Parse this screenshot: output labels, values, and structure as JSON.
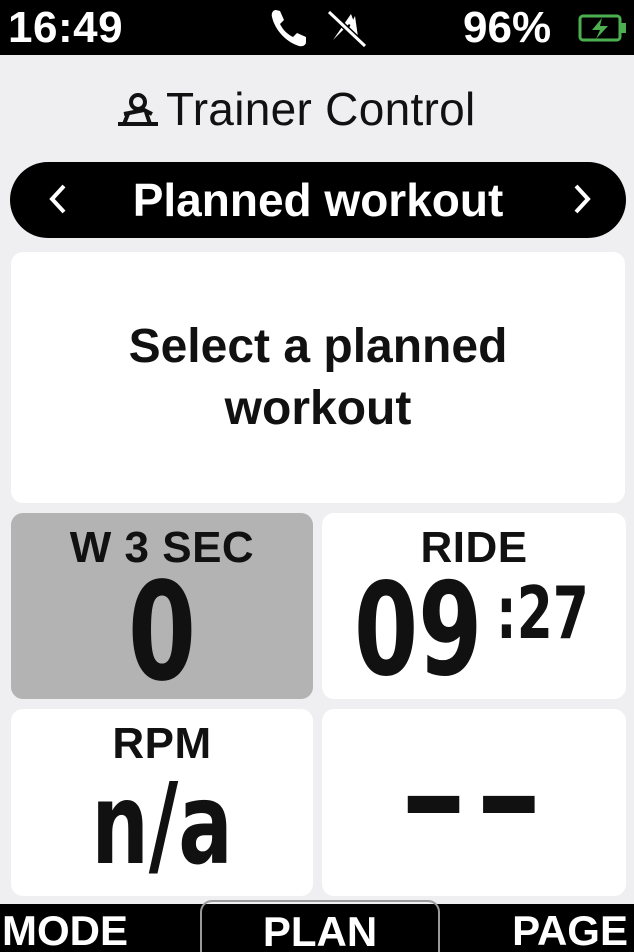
{
  "status_bar": {
    "time": "16:49",
    "battery_percent": "96%",
    "icons": [
      "phone-icon",
      "no-signal-icon",
      "battery-charging-icon"
    ],
    "battery_icon_color": "#4caf50"
  },
  "header": {
    "title": "Trainer Control",
    "icon": "trainer-icon"
  },
  "mode_selector": {
    "label": "Planned workout",
    "prev_icon": "chevron-left-icon",
    "next_icon": "chevron-right-icon"
  },
  "message": {
    "text": "Select a planned workout"
  },
  "tiles": {
    "power": {
      "label": "W 3 SEC",
      "value": "0"
    },
    "ride": {
      "label": "RIDE",
      "value_min": "09",
      "value_sec": ":27"
    },
    "rpm": {
      "label": "RPM",
      "value": "n/a"
    },
    "empty": {
      "label": "",
      "value": "--"
    }
  },
  "bottom_bar": {
    "mode": "MODE",
    "plan": "PLAN",
    "page": "PAGE"
  }
}
